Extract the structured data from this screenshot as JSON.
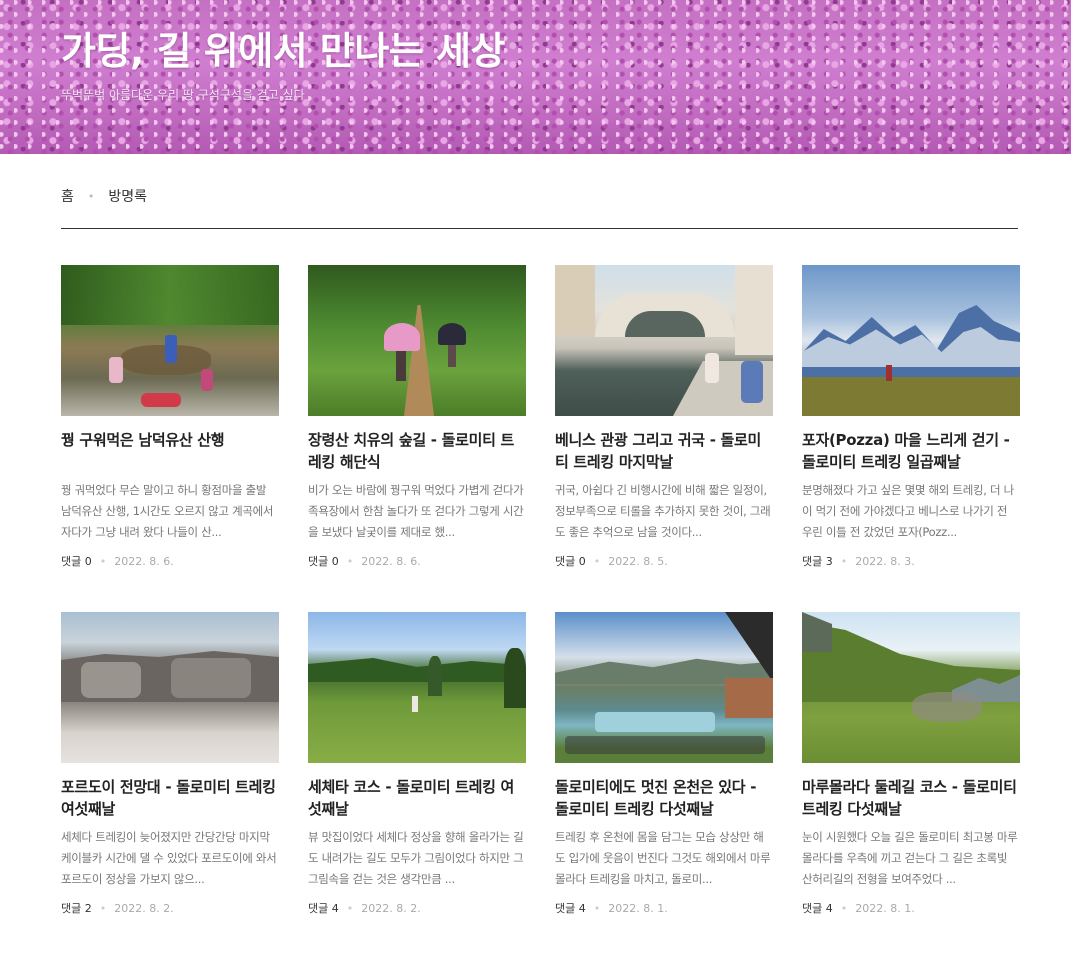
{
  "site": {
    "title": "가딩, 길 위에서 만나는 세상",
    "subtitle": "뚜벅뚜벅 아름다운 우리 땅 구석구석을 걷고 싶다"
  },
  "nav": {
    "home": "홈",
    "guestbook": "방명록"
  },
  "posts": [
    {
      "title": "꿩 구워먹은 남덕유산 산행",
      "excerpt": "꿩 궈먹었다 무슨 말이고 하니 황점마을 출발 남덕유산 산행, 1시간도 오르지 않고 계곡에서 자다가 그냥 내려 왔다 나들이 산...",
      "comments": "댓글 0",
      "date": "2022. 8. 6.",
      "image": "forest-stream"
    },
    {
      "title": "장령산 치유의 숲길 - 돌로미티 트레킹 해단식",
      "excerpt": "비가 오는 바람에 꿩구워 먹었다 가볍게 걷다가 족욕장에서 한참 놀다가 또 걷다가 그렇게 시간을 보냈다 날궂이를 제대로 했...",
      "comments": "댓글 0",
      "date": "2022. 8. 6.",
      "image": "forest-path-umbrellas"
    },
    {
      "title": "베니스 관광 그리고 귀국 - 돌로미티 트레킹 마지막날",
      "excerpt": "귀국, 아쉽다 긴 비행시간에 비해 짧은 일정이, 정보부족으로 티롤을 추가하지 못한 것이, 그래도 좋은 추억으로 남을 것이다...",
      "comments": "댓글 0",
      "date": "2022. 8. 5.",
      "image": "venice-bridge"
    },
    {
      "title": "포자(Pozza) 마을 느리게 걷기 - 돌로미티 트레킹 일곱째날",
      "excerpt": "분명해졌다 가고 싶은 몇몇 해외 트레킹, 더 나이 먹기 전에 가야겠다고 베니스로 나가기 전 우린 이틀 전 갔었던 포자(Pozz...",
      "comments": "댓글 3",
      "date": "2022. 8. 3.",
      "image": "alps-peaks"
    },
    {
      "title": "포르도이 전망대 - 돌로미티 트레킹 여섯째날",
      "excerpt": "세체다 트레킹이 늦어졌지만 간당간당 마지막 케이블카 시간에 댈 수 있었다 포르도이에 와서 포르도이 정상을 가보지 않으...",
      "comments": "댓글 2",
      "date": "2022. 8. 2.",
      "image": "rock-plateau"
    },
    {
      "title": "세체타 코스 - 돌로미티 트레킹 여섯째날",
      "excerpt": "뷰 맛집이었다 세체다 정상을 향해 올라가는 길도 내려가는 길도 모두가 그림이었다 하지만 그 그림속을 걷는 것은 생각만큼 ...",
      "comments": "댓글 4",
      "date": "2022. 8. 2.",
      "image": "green-meadow"
    },
    {
      "title": "돌로미티에도 멋진 온천은 있다 - 돌로미티 트레킹 다섯째날",
      "excerpt": "트레킹 후 온천에 몸을 담그는 모습 상상만 해도 입가에 웃음이 번진다 그것도 해외에서 마루몰라다 트레킹을 마치고, 돌로미...",
      "comments": "댓글 4",
      "date": "2022. 8. 1.",
      "image": "thermal-pool"
    },
    {
      "title": "마루몰라다 둘레길 코스 - 돌로미티 트레킹 다섯째날",
      "excerpt": "눈이 시원했다 오늘 길은 돌로미티 최고봉 마루몰라다를 우측에 끼고 걷는다 그 길은 초록빛 산허리길의 전형을 보여주었다 ...",
      "comments": "댓글 4",
      "date": "2022. 8. 1.",
      "image": "green-ridge"
    }
  ],
  "colors": {
    "header_bg": "#c571c3",
    "divider": "#333333",
    "text": "#222222",
    "muted": "#777777"
  }
}
